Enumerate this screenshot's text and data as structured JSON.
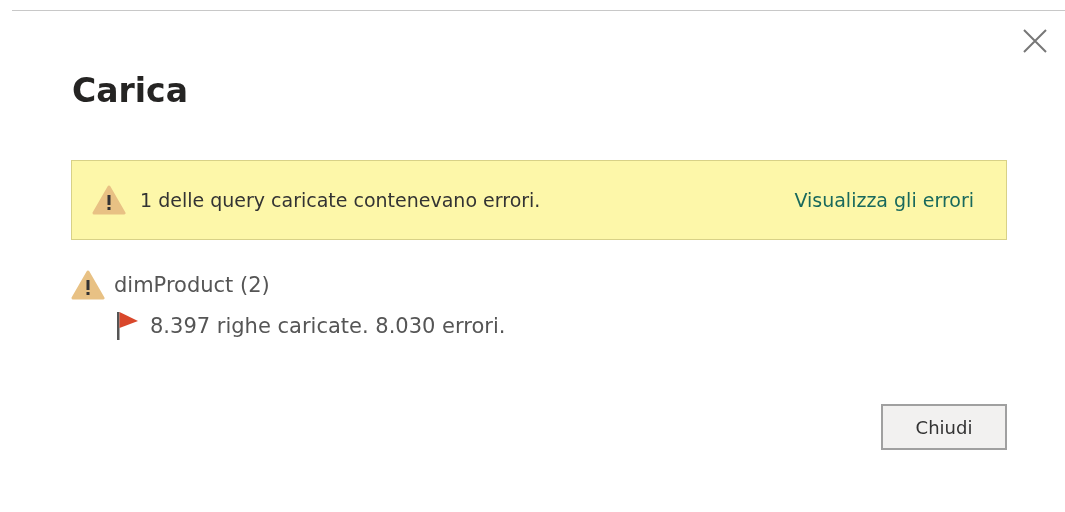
{
  "dialog": {
    "title": "Carica"
  },
  "banner": {
    "message": "1 delle query caricate contenevano errori.",
    "link": "Visualizza gli errori"
  },
  "queries": [
    {
      "name": "dimProduct (2)",
      "details": [
        {
          "text": "8.397 righe caricate. 8.030 errori."
        }
      ]
    }
  ],
  "buttons": [
    "Chiudi"
  ]
}
